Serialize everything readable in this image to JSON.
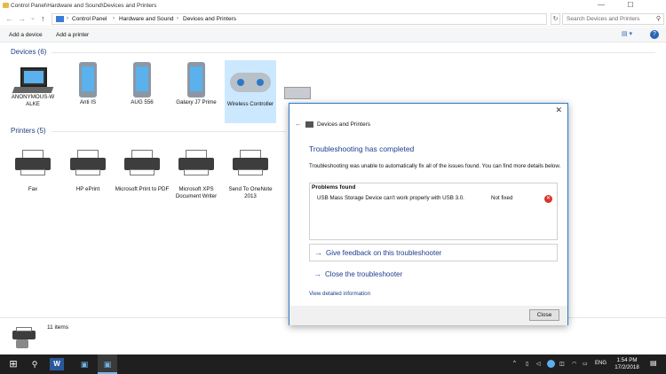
{
  "window": {
    "title": "Control Panel\\Hardware and Sound\\Devices and Printers",
    "controls": {
      "minimize": "—",
      "maximize": "☐"
    }
  },
  "address": {
    "crumbs": [
      "Control Panel",
      "Hardware and Sound",
      "Devices and Printers"
    ],
    "refresh": "↻",
    "search_placeholder": "Search Devices and Printers"
  },
  "nav": {
    "back": "←",
    "forward": "→",
    "down": "⌄",
    "up": "↑"
  },
  "commands": {
    "add_device": "Add a device",
    "add_printer": "Add a printer",
    "view": "▤ ▾",
    "help": "?"
  },
  "devices": {
    "heading": "Devices (6)",
    "items": [
      {
        "label": "ANONYMOUS-W ALKE"
      },
      {
        "label": "Anti IS"
      },
      {
        "label": "AUG 556"
      },
      {
        "label": "Galaxy J7 Prime"
      },
      {
        "label": "Wireless Controller"
      }
    ]
  },
  "printers": {
    "heading": "Printers (5)",
    "items": [
      {
        "label": "Fax"
      },
      {
        "label": "HP ePrint"
      },
      {
        "label": "Microsoft Print to PDF"
      },
      {
        "label": "Microsoft XPS Document Writer"
      },
      {
        "label": "Send To OneNote 2013"
      }
    ]
  },
  "status": {
    "count": "11 items"
  },
  "dialog": {
    "title": "Devices and Printers",
    "back": "←",
    "close": "✕",
    "heading": "Troubleshooting has completed",
    "description": "Troubleshooting was unable to automatically fix all of the issues found. You can find more details below.",
    "problems_header": "Problems found",
    "problem": {
      "name": "USB Mass Storage Device can't work properly with USB 3.0.",
      "status": "Not fixed",
      "icon": "✕"
    },
    "feedback_link": "Give feedback on this troubleshooter",
    "close_link": "Close the troubleshooter",
    "link_arrow": "→",
    "view_info": "View detailed information",
    "close_button": "Close"
  },
  "taskbar": {
    "start": "⊞",
    "search": "⚲",
    "apps": [
      "W",
      "▣",
      "▣"
    ],
    "tray": {
      "arrow": "^",
      "lang": "ENG"
    },
    "clock": {
      "time": "1:54 PM",
      "date": "17/2/2018"
    }
  }
}
